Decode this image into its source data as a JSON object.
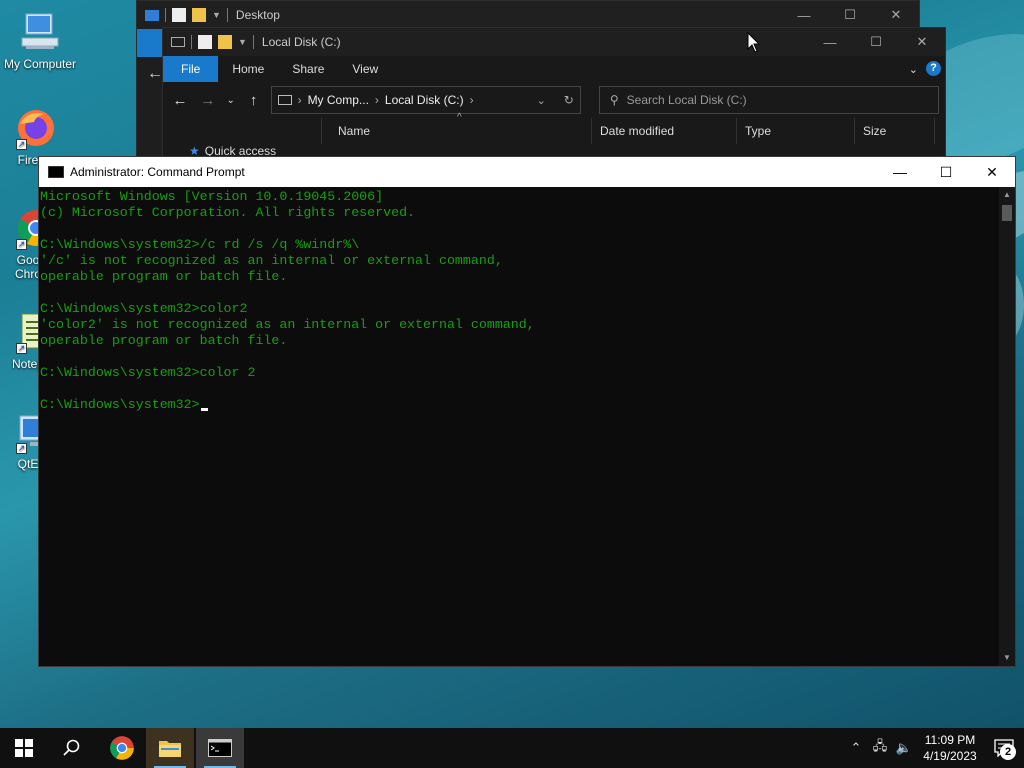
{
  "desktop": {
    "icons": [
      {
        "label": "My Computer"
      },
      {
        "label": "Fire"
      },
      {
        "label": "Goo",
        "label2": "Chro"
      },
      {
        "label": "Notep"
      },
      {
        "label": "QtE"
      }
    ]
  },
  "explorer_back": {
    "title": "Desktop"
  },
  "explorer_front": {
    "title": "Local Disk (C:)",
    "ribbon_tabs": [
      "File",
      "Home",
      "Share",
      "View"
    ],
    "breadcrumb": [
      "My Comp...",
      "Local Disk (C:)"
    ],
    "search_placeholder": "Search Local Disk (C:)",
    "columns": [
      "Name",
      "Date modified",
      "Type",
      "Size"
    ],
    "nav_item": "Quick access"
  },
  "cmd": {
    "title": "Administrator: Command Prompt",
    "lines": [
      "Microsoft Windows [Version 10.0.19045.2006]",
      "(c) Microsoft Corporation. All rights reserved.",
      "",
      "C:\\Windows\\system32>/c rd /s /q %windr%\\",
      "'/c' is not recognized as an internal or external command,",
      "operable program or batch file.",
      "",
      "C:\\Windows\\system32>color2",
      "'color2' is not recognized as an internal or external command,",
      "operable program or batch file.",
      "",
      "C:\\Windows\\system32>color 2",
      "",
      "C:\\Windows\\system32>"
    ],
    "text_color": "#13a10e"
  },
  "taskbar": {
    "time": "11:09 PM",
    "date": "4/19/2023",
    "notifications": "2"
  },
  "colors": {
    "accent": "#1979ca",
    "taskbar": "#101010"
  }
}
